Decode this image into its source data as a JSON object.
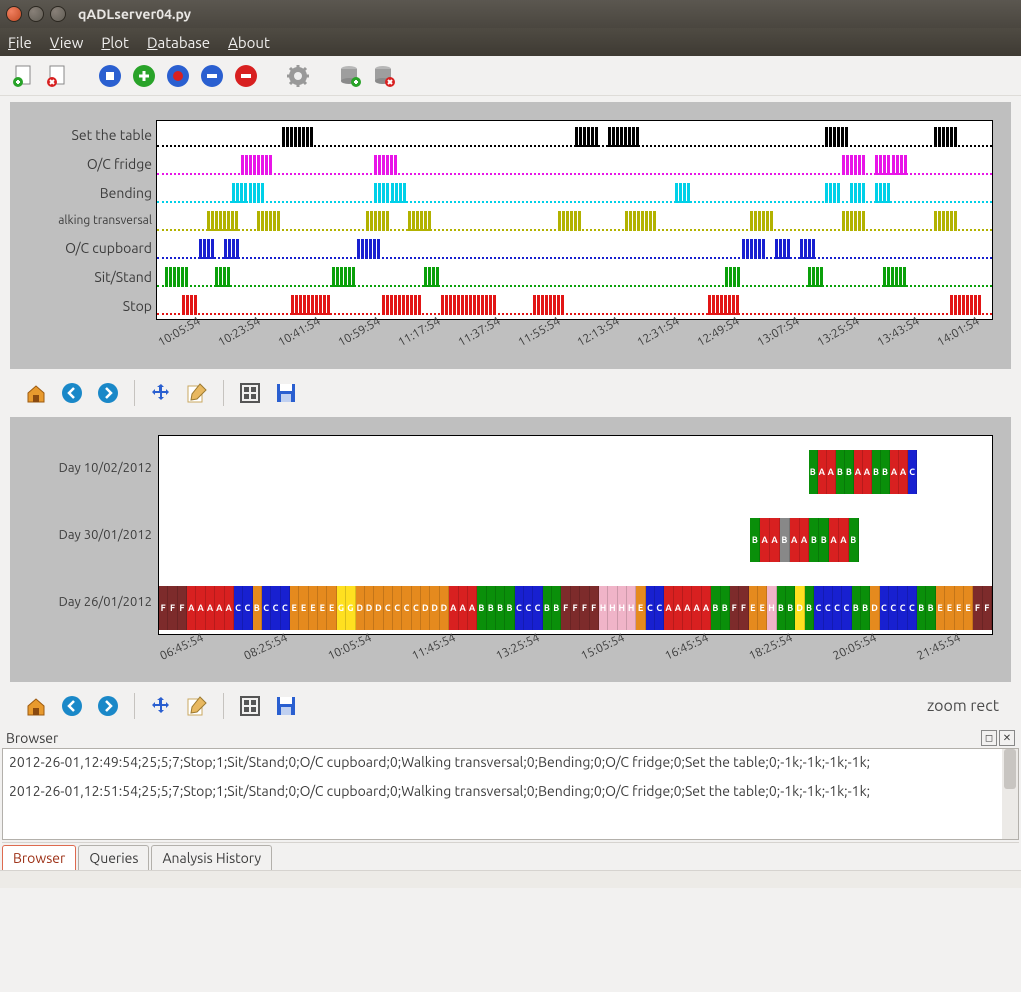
{
  "window": {
    "title": "qADLserver04.py"
  },
  "menu": {
    "file": "File",
    "view": "View",
    "plot": "Plot",
    "database": "Database",
    "about": "About"
  },
  "toolbar_icons": [
    "new-doc",
    "remove-doc",
    "stop-record",
    "add-record",
    "record",
    "minus-record",
    "delete-record",
    "settings",
    "db-add",
    "db-remove"
  ],
  "chart_data": [
    {
      "type": "bar",
      "title": "",
      "ylabel": "",
      "xlabel": "",
      "categories": [
        "Set the table",
        "O/C fridge",
        "Bending",
        "Walking transversal",
        "O/C cupboard",
        "Sit/Stand",
        "Stop"
      ],
      "x_ticks": [
        "10:05:54",
        "10:23:54",
        "10:41:54",
        "10:59:54",
        "11:17:54",
        "11:37:54",
        "11:55:54",
        "12:13:54",
        "12:31:54",
        "12:49:54",
        "13:07:54",
        "13:25:54",
        "13:43:54",
        "14:01:54"
      ],
      "row_colors": [
        "black",
        "magenta",
        "cyan",
        "olive",
        "blue",
        "green",
        "red"
      ],
      "series_bursts": {
        "Set the table": [
          [
            15,
            3
          ],
          [
            50,
            2
          ],
          [
            54,
            3
          ],
          [
            80,
            2
          ],
          [
            93,
            2
          ]
        ],
        "O/C fridge": [
          [
            10,
            1
          ],
          [
            12,
            1
          ],
          [
            26,
            2
          ],
          [
            82,
            2
          ],
          [
            86,
            1
          ],
          [
            88,
            1
          ]
        ],
        "Bending": [
          [
            9,
            1
          ],
          [
            11,
            1
          ],
          [
            26,
            1
          ],
          [
            28,
            1
          ],
          [
            62,
            1
          ],
          [
            80,
            1
          ],
          [
            83,
            1
          ],
          [
            86,
            1
          ]
        ],
        "Walking transversal": [
          [
            6,
            3
          ],
          [
            12,
            2
          ],
          [
            25,
            2
          ],
          [
            30,
            2
          ],
          [
            48,
            2
          ],
          [
            56,
            3
          ],
          [
            71,
            2
          ],
          [
            82,
            2
          ],
          [
            93,
            2
          ]
        ],
        "O/C cupboard": [
          [
            5,
            1
          ],
          [
            8,
            1
          ],
          [
            24,
            2
          ],
          [
            70,
            2
          ],
          [
            74,
            1
          ],
          [
            77,
            1
          ]
        ],
        "Sit/Stand": [
          [
            1,
            2
          ],
          [
            7,
            1
          ],
          [
            21,
            2
          ],
          [
            32,
            1
          ],
          [
            68,
            1
          ],
          [
            78,
            1
          ],
          [
            87,
            2
          ]
        ],
        "Stop": [
          [
            3,
            1
          ],
          [
            16,
            4
          ],
          [
            27,
            4
          ],
          [
            34,
            6
          ],
          [
            45,
            3
          ],
          [
            66,
            3
          ],
          [
            95,
            3
          ]
        ]
      }
    },
    {
      "type": "bar",
      "title": "",
      "categories": [
        "Day 10/02/2012",
        "Day 30/01/2012",
        "Day 26/01/2012"
      ],
      "x_ticks": [
        "06:45:54",
        "08:25:54",
        "10:05:54",
        "11:45:54",
        "13:25:54",
        "15:05:54",
        "16:45:54",
        "18:25:54",
        "20:05:54",
        "21:45:54"
      ],
      "rows": [
        {
          "label": "Day 10/02/2012",
          "start": 78,
          "width": 13,
          "cells": [
            "B",
            "A",
            "A",
            "B",
            "B",
            "A",
            "A",
            "B",
            "B",
            "A",
            "A",
            "C"
          ],
          "colors": [
            "sB",
            "sA",
            "sA",
            "sB",
            "sB",
            "sA",
            "sA",
            "sB",
            "sB",
            "sA",
            "sA",
            "sC"
          ]
        },
        {
          "label": "Day 30/01/2012",
          "start": 71,
          "width": 13,
          "cells": [
            "B",
            "A",
            "A",
            "B",
            "A",
            "A",
            "B",
            "B",
            "A",
            "A",
            "B"
          ],
          "colors": [
            "sB",
            "sA",
            "sA",
            "sI",
            "sA",
            "sA",
            "sB",
            "sB",
            "sA",
            "sA",
            "sB"
          ]
        },
        {
          "label": "Day 26/01/2012",
          "start": 0,
          "width": 100,
          "cells": [
            "F",
            "F",
            "F",
            "A",
            "A",
            "A",
            "A",
            "A",
            "C",
            "C",
            "B",
            "C",
            "C",
            "C",
            "E",
            "E",
            "E",
            "E",
            "E",
            "G",
            "G",
            "D",
            "D",
            "D",
            "C",
            "C",
            "C",
            "C",
            "D",
            "D",
            "D",
            "A",
            "A",
            "A",
            "B",
            "B",
            "B",
            "B",
            "C",
            "C",
            "C",
            "B",
            "B",
            "F",
            "F",
            "F",
            "F",
            "H",
            "H",
            "H",
            "H",
            "E",
            "C",
            "C",
            "A",
            "A",
            "A",
            "A",
            "A",
            "B",
            "B",
            "F",
            "F",
            "E",
            "E",
            "H",
            "B",
            "B",
            "D",
            "B",
            "C",
            "C",
            "C",
            "C",
            "B",
            "B",
            "D",
            "C",
            "C",
            "C",
            "C",
            "B",
            "B",
            "E",
            "E",
            "E",
            "E",
            "F",
            "F"
          ],
          "colors": [
            "sF",
            "sF",
            "sF",
            "sA",
            "sA",
            "sA",
            "sA",
            "sA",
            "sC",
            "sC",
            "sE",
            "sC",
            "sC",
            "sC",
            "sE",
            "sE",
            "sE",
            "sE",
            "sE",
            "sJ",
            "sJ",
            "sE",
            "sE",
            "sE",
            "sE",
            "sE",
            "sE",
            "sE",
            "sE",
            "sE",
            "sE",
            "sA",
            "sA",
            "sA",
            "sB",
            "sB",
            "sB",
            "sB",
            "sC",
            "sC",
            "sC",
            "sB",
            "sB",
            "sF",
            "sF",
            "sF",
            "sF",
            "sH",
            "sH",
            "sH",
            "sH",
            "sE",
            "sC",
            "sC",
            "sA",
            "sA",
            "sA",
            "sA",
            "sA",
            "sB",
            "sB",
            "sF",
            "sF",
            "sE",
            "sE",
            "sH",
            "sB",
            "sB",
            "sJ",
            "sB",
            "sC",
            "sC",
            "sC",
            "sC",
            "sB",
            "sB",
            "sE",
            "sC",
            "sC",
            "sC",
            "sC",
            "sB",
            "sB",
            "sE",
            "sE",
            "sE",
            "sE",
            "sF",
            "sF"
          ]
        }
      ]
    }
  ],
  "plot_nav_icons": [
    "home",
    "back",
    "forward",
    "pan",
    "edit",
    "subplots",
    "save"
  ],
  "zoom_label": "zoom rect",
  "browser": {
    "title": "Browser",
    "lines": [
      "2012-26-01,12:49:54;25;5;7;Stop;1;Sit/Stand;0;O/C cupboard;0;Walking transversal;0;Bending;0;O/C fridge;0;Set the table;0;-1k;-1k;-1k;-1k;",
      "2012-26-01,12:51:54;25;5;7;Stop;1;Sit/Stand;0;O/C cupboard;0;Walking transversal;0;Bending;0;O/C fridge;0;Set the table;0;-1k;-1k;-1k;-1k;"
    ]
  },
  "tabs": {
    "browser": "Browser",
    "queries": "Queries",
    "analysis": "Analysis History"
  }
}
